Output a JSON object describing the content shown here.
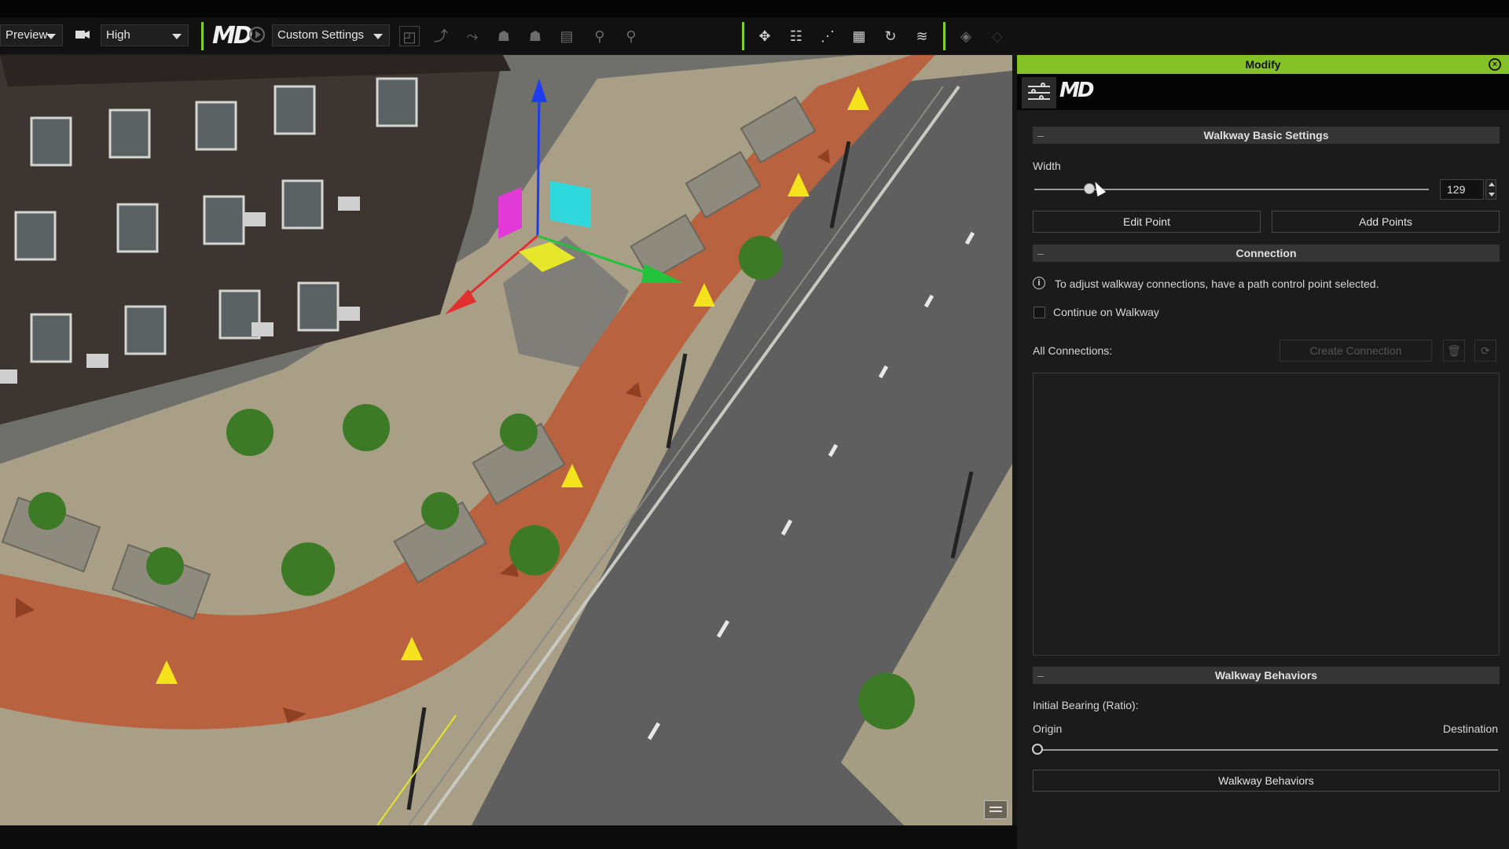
{
  "toolbar": {
    "preview_label": "Preview",
    "quality_label": "High",
    "settings_label": "Custom Settings",
    "logo_text": "MD"
  },
  "panel": {
    "title": "Modify",
    "tab_logo": "MD",
    "basic_settings": {
      "header": "Walkway Basic Settings",
      "width_label": "Width",
      "width_value": "129",
      "width_fraction": 0.14,
      "edit_point_label": "Edit Point",
      "add_points_label": "Add Points"
    },
    "connection": {
      "header": "Connection",
      "info_text": "To adjust walkway connections, have a path control point selected.",
      "continue_label": "Continue on Walkway",
      "continue_checked": false,
      "all_connections_label": "All Connections:",
      "create_connection_label": "Create Connection"
    },
    "behaviors": {
      "header": "Walkway Behaviors",
      "initial_bearing_label": "Initial Bearing (Ratio):",
      "origin_label": "Origin",
      "destination_label": "Destination",
      "bearing_fraction": 0.0,
      "button_label": "Walkway Behaviors"
    }
  },
  "colors": {
    "accent_green": "#84c225",
    "panel_bg": "#1b1b1b",
    "walkway_path": "#b8623f",
    "gizmo_x": "#e23030",
    "gizmo_y": "#22c23a",
    "gizmo_z": "#1f3df0"
  },
  "icons": [
    "camera-icon",
    "play-icon",
    "crowd-icon",
    "grid-icon",
    "refresh-icon",
    "sliders-icon",
    "info-icon",
    "trash-icon",
    "cycle-icon",
    "chat-icon"
  ]
}
